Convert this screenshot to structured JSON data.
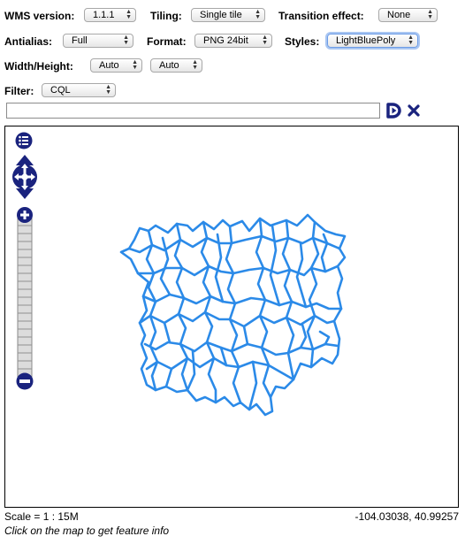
{
  "toolbar": {
    "wms_version": {
      "label": "WMS version:",
      "value": "1.1.1"
    },
    "tiling": {
      "label": "Tiling:",
      "value": "Single tile"
    },
    "transition_effect": {
      "label": "Transition effect:",
      "value": "None"
    },
    "antialias": {
      "label": "Antialias:",
      "value": "Full"
    },
    "format": {
      "label": "Format:",
      "value": "PNG 24bit"
    },
    "styles": {
      "label": "Styles:",
      "value": "LightBluePoly"
    },
    "width_height": {
      "label": "Width/Height:",
      "width_value": "Auto",
      "height_value": "Auto"
    },
    "filter": {
      "label": "Filter:",
      "value": "CQL"
    }
  },
  "filter_input": {
    "value": "",
    "placeholder": ""
  },
  "icons": {
    "apply": "apply-filter-icon",
    "reset": "reset-filter-icon",
    "layer_switcher": "layer-switcher-icon",
    "pan": "pan-control-icon",
    "zoom_in": "zoom-in-icon",
    "zoom_out": "zoom-out-icon"
  },
  "colors": {
    "control_navy": "#1a237e",
    "polygon_stroke": "#2b8ae8",
    "focus_ring": "#6b9be6"
  },
  "status": {
    "scale": "Scale = 1 : 15M",
    "coordinates": "-104.03038, 40.99257",
    "hint": "Click on the map to get feature info"
  }
}
